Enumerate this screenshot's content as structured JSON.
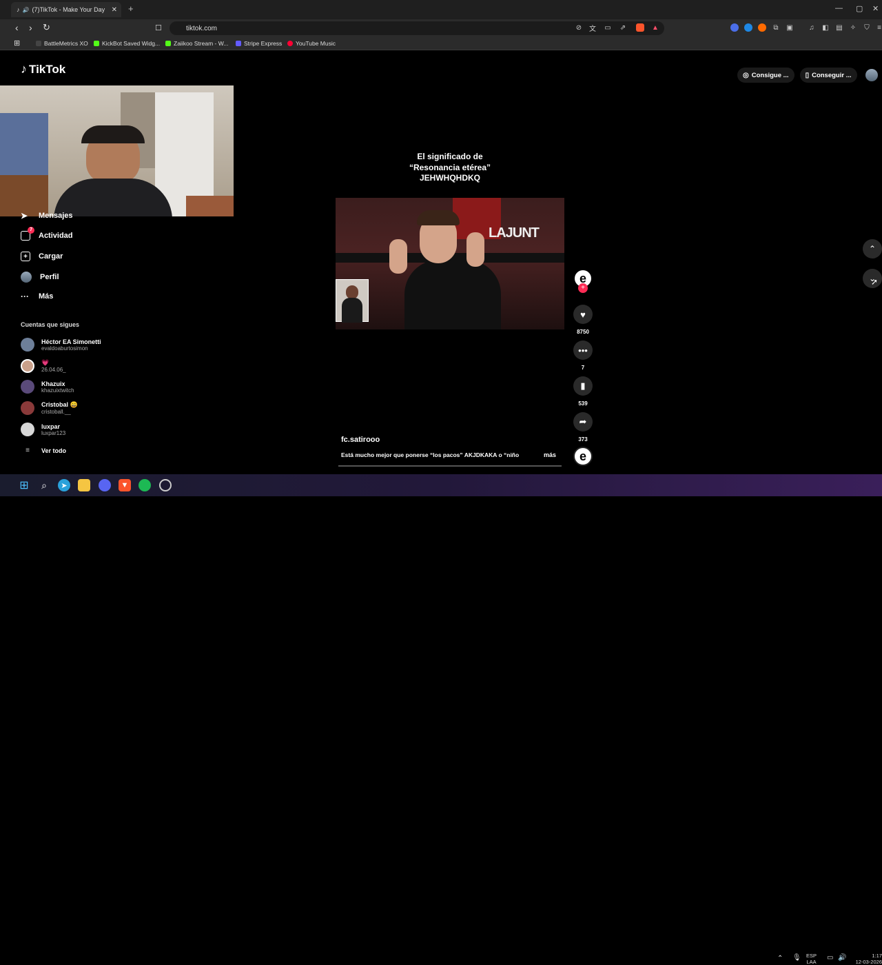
{
  "browser": {
    "tab_title": "(7)TikTok - Make Your Day",
    "url": "tiktok.com",
    "bookmarks": [
      {
        "label": "BattleMetrics XO",
        "color": "#444"
      },
      {
        "label": "KickBot Saved Widg...",
        "color": "#53fc18"
      },
      {
        "label": "Zaiikoo Stream - W...",
        "color": "#53fc18"
      },
      {
        "label": "Stripe Express",
        "color": "#635bff"
      },
      {
        "label": "YouTube Music",
        "color": "#ff0033"
      }
    ]
  },
  "tiktok": {
    "logo": "TikTok",
    "nav": [
      {
        "label": "Mensajes",
        "icon": "send-icon"
      },
      {
        "label": "Actividad",
        "icon": "activity-icon",
        "badge": "7"
      },
      {
        "label": "Cargar",
        "icon": "upload-icon"
      },
      {
        "label": "Perfil",
        "icon": "avatar-icon"
      },
      {
        "label": "Más",
        "icon": "more-icon"
      }
    ],
    "following_title": "Cuentas que sigues",
    "following": [
      {
        "name": "Héctor EA Simonetti",
        "handle": "evaldoaburtosimon",
        "color": "#6d7f99"
      },
      {
        "name": "💗",
        "handle": "26.04.06_",
        "color": "#c9a08a"
      },
      {
        "name": "Khazuix",
        "handle": "khazuixtwitch",
        "color": "#5a4a7a"
      },
      {
        "name": "Cristobal 😄",
        "handle": "cristoball.__",
        "color": "#8a3a3a"
      },
      {
        "name": "luxpar",
        "handle": "luxpar123",
        "color": "#d8d8d8"
      }
    ],
    "see_all": "Ver todo",
    "top_right": {
      "coins": "Consigue ...",
      "app": "Conseguir ..."
    },
    "video": {
      "caption_line1": "El significado de",
      "caption_line2": "“Resonancia etérea”",
      "caption_line3": "JEHWHQHDKQ",
      "author": "fc.satirooo",
      "description": "Está mucho mejor que ponerse “los pacos” AKJDKAKA o “niño",
      "more": "más",
      "likes": "8750",
      "comments": "7",
      "saves": "539",
      "shares": "373",
      "progress": 0.0
    }
  },
  "taskbar": {
    "lang1": "ESP",
    "lang2": "LAA",
    "time": "1:17",
    "date": "12-03-2026"
  }
}
